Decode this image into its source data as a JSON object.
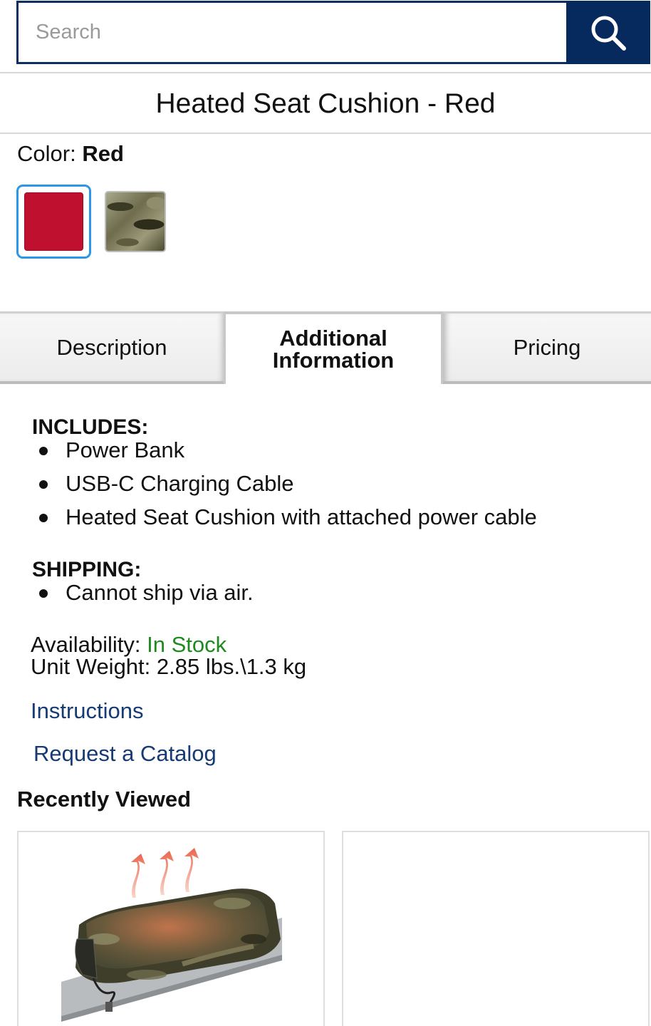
{
  "search": {
    "placeholder": "Search",
    "value": ""
  },
  "product": {
    "title": "Heated Seat Cushion - Red",
    "color_label": "Color:",
    "color_value": "Red",
    "swatches": [
      {
        "name": "Red",
        "color": "#c01030",
        "selected": true
      },
      {
        "name": "Camo",
        "selected": false
      }
    ]
  },
  "tabs": [
    {
      "label": "Description",
      "active": false
    },
    {
      "label": "Additional Information",
      "active": true
    },
    {
      "label": "Pricing",
      "active": false
    }
  ],
  "info": {
    "includes_heading": "INCLUDES:",
    "includes": [
      "Power Bank",
      "USB-C Charging Cable",
      "Heated Seat Cushion with attached power cable"
    ],
    "shipping_heading": "SHIPPING:",
    "shipping": [
      "Cannot ship via air."
    ],
    "availability_label": "Availability:",
    "availability_value": "In Stock",
    "unit_weight": "Unit Weight: 2.85 lbs.\\1.3 kg"
  },
  "links": {
    "instructions": "Instructions",
    "catalog": "Request a Catalog"
  },
  "recently_viewed": {
    "title": "Recently Viewed"
  },
  "colors": {
    "brand": "#062a5e",
    "link": "#163a73",
    "in_stock": "#1f8a1f",
    "swatch_outline": "#2c97e8"
  },
  "icons": [
    "search-icon"
  ]
}
